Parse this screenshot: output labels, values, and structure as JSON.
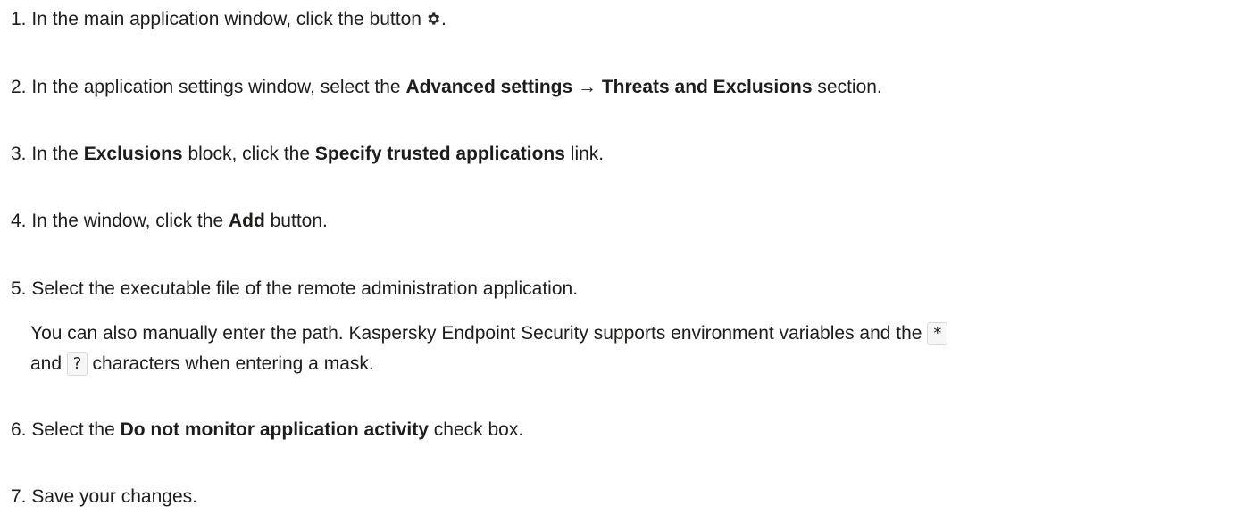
{
  "steps": [
    {
      "num": "1.",
      "before": " In the main application window, click the button",
      "icon": "gear-icon",
      "after": "."
    },
    {
      "num": "2.",
      "before": " In the application settings window, select the ",
      "bold1": "Advanced settings → Threats and Exclusions",
      "after": " section."
    },
    {
      "num": "3.",
      "before": " In the ",
      "bold1": "Exclusions",
      "middle": " block, click the ",
      "bold2": "Specify trusted applications",
      "after": " link."
    },
    {
      "num": "4.",
      "before": " In the window, click the ",
      "bold1": "Add",
      "after": " button."
    },
    {
      "num": "5.",
      "text": " Select the executable file of the remote administration application.",
      "note": {
        "before": "You can also manually enter the path. Kaspersky Endpoint Security supports environment variables and the ",
        "code1": "*",
        "middle": " and ",
        "code2": "?",
        "after": " characters when entering a mask."
      }
    },
    {
      "num": "6.",
      "before": " Select the ",
      "bold1": "Do not monitor application activity",
      "after": " check box."
    },
    {
      "num": "7.",
      "text": " Save your changes."
    }
  ]
}
